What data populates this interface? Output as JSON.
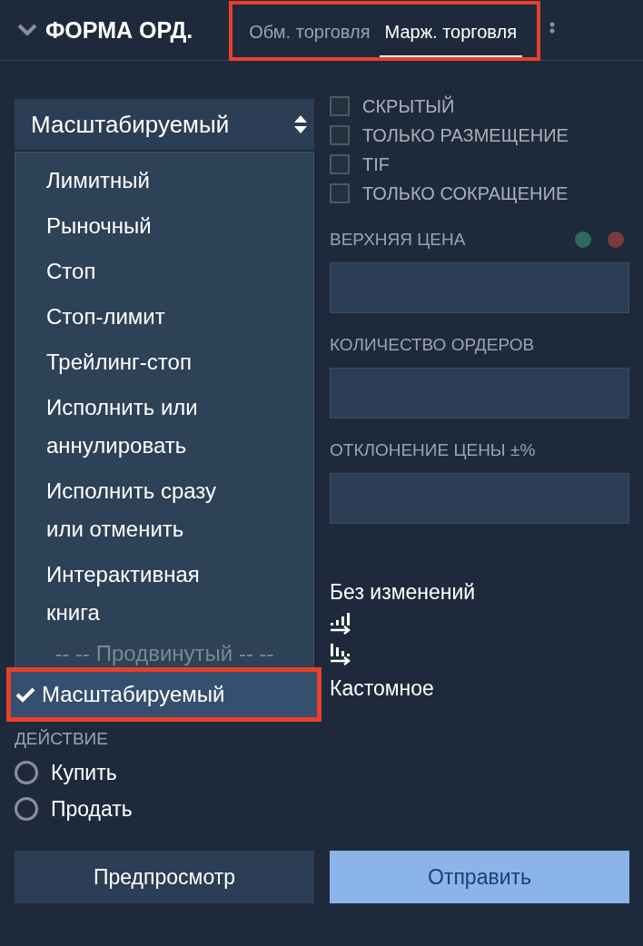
{
  "header": {
    "title": "ФОРМА ОРД.",
    "tabs_highlighted": true,
    "tabs": [
      {
        "label": "Обм. торговля",
        "selected": false
      },
      {
        "label": "Марж. торговля",
        "selected": true
      }
    ]
  },
  "order_type": {
    "value": "Масштабируемый",
    "options": [
      {
        "kind": "option",
        "label": "Лимитный",
        "selected": false,
        "highlighted": false
      },
      {
        "kind": "option",
        "label": "Рыночный",
        "selected": false,
        "highlighted": false
      },
      {
        "kind": "option",
        "label": "Стоп",
        "selected": false,
        "highlighted": false
      },
      {
        "kind": "option",
        "label": "Стоп-лимит",
        "selected": false,
        "highlighted": false
      },
      {
        "kind": "option",
        "label": "Трейлинг-стоп",
        "selected": false,
        "highlighted": false
      },
      {
        "kind": "option",
        "label": "Исполнить или аннулировать",
        "selected": false,
        "highlighted": false
      },
      {
        "kind": "option",
        "label": "Исполнить сразу или отменить",
        "selected": false,
        "highlighted": false
      },
      {
        "kind": "option",
        "label": "Интерактивная книга",
        "selected": false,
        "highlighted": false
      },
      {
        "kind": "group",
        "label": "-- -- Продвинутый -- --"
      },
      {
        "kind": "option",
        "label": "Масштабируемый",
        "selected": true,
        "highlighted": true
      }
    ]
  },
  "action": {
    "label": "ДЕЙСТВИЕ",
    "options": [
      {
        "label": "Купить",
        "selected": false
      },
      {
        "label": "Продать",
        "selected": false
      }
    ]
  },
  "flags": [
    {
      "label": "СКРЫТЫЙ",
      "checked": false
    },
    {
      "label": "ТОЛЬКО РАЗМЕЩЕНИЕ",
      "checked": false
    },
    {
      "label": "TIF",
      "checked": false
    },
    {
      "label": "ТОЛЬКО СОКРАЩЕНИЕ",
      "checked": false
    }
  ],
  "fields": [
    {
      "label": "ВЕРХНЯЯ ЦЕНА",
      "dots": [
        {
          "color": "#2f6a5e"
        },
        {
          "color": "#7a3a3f"
        }
      ]
    },
    {
      "label": "КОЛИЧЕСТВО ОРДЕРОВ"
    },
    {
      "label": "ОТКЛОНЕНИЕ ЦЕНЫ ±%"
    }
  ],
  "distribution": [
    {
      "kind": "text",
      "label": "Без изменений"
    },
    {
      "kind": "increasing"
    },
    {
      "kind": "decreasing"
    },
    {
      "kind": "text",
      "label": "Кастомное"
    }
  ],
  "buttons": [
    {
      "label": "Предпросмотр",
      "disabled": false,
      "kind": "secondary"
    },
    {
      "label": "Отправить",
      "disabled": true,
      "kind": "primary"
    }
  ]
}
